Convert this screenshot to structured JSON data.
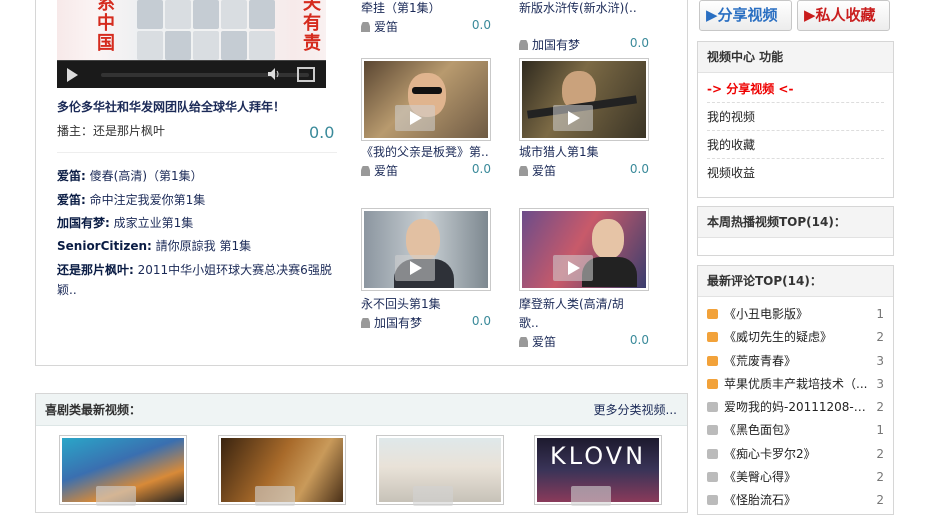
{
  "top_buttons": {
    "share": "▶分享视频",
    "collect": "▶私人收藏"
  },
  "featured": {
    "thumb_text_left": [
      "系",
      "中",
      "国"
    ],
    "thumb_text_right": [
      "夫",
      "有",
      "责"
    ],
    "title": "多伦多华社和华发网团队给全球华人拜年！",
    "uploader_label": "播主：还是那片枫叶",
    "score": "0.0"
  },
  "comments": [
    {
      "user": "爱笛:",
      "text": "傻春(高清)（第1集）"
    },
    {
      "user": "爱笛:",
      "text": "命中注定我爱你第1集"
    },
    {
      "user": "加国有梦:",
      "text": "成家立业第1集"
    },
    {
      "user": "SeniorCitizen:",
      "text": "請你原諒我 第1集"
    },
    {
      "user": "还是那片枫叶:",
      "text": "2011中华小姐环球大赛总决赛6强脱颖.."
    }
  ],
  "videos": {
    "v0": {
      "title": "牵挂（第1集）",
      "user": "爱笛",
      "score": "0.0"
    },
    "v1": {
      "title": "新版水浒传(新水浒)(..",
      "user": "加国有梦",
      "score": "0.0"
    },
    "v2": {
      "title": "《我的父亲是板凳》第..",
      "user": "爱笛",
      "score": "0.0"
    },
    "v3": {
      "title": "城市猎人第1集",
      "user": "爱笛",
      "score": "0.0"
    },
    "v4": {
      "title": "永不回头第1集",
      "user": "加国有梦",
      "score": "0.0"
    },
    "v5": {
      "title": "摩登新人类(高清/胡歌..",
      "user": "爱笛",
      "score": "0.0"
    }
  },
  "sidebar": {
    "func_title": "视频中心 功能",
    "func_items": [
      "-> 分享视频 <-",
      "我的视频",
      "我的收藏",
      "视频收益"
    ],
    "hot_title": "本周热播视频TOP(14)：",
    "comment_title": "最新评论TOP(14)：",
    "ranks": [
      {
        "text": "《小丑电影版》",
        "num": "1",
        "color": "#f2a23a"
      },
      {
        "text": "《威切先生的疑虑》",
        "num": "2",
        "color": "#f2a23a"
      },
      {
        "text": "《荒废青春》",
        "num": "3",
        "color": "#f2a23a"
      },
      {
        "text": "苹果优质丰产栽培技术（...",
        "num": "3",
        "color": "#f2a23a"
      },
      {
        "text": "爱吻我的妈-20111208-性...",
        "num": "2",
        "color": "#bbbbbb"
      },
      {
        "text": "《黑色面包》",
        "num": "1",
        "color": "#bbbbbb"
      },
      {
        "text": "《痴心卡罗尔2》",
        "num": "2",
        "color": "#bbbbbb"
      },
      {
        "text": "《美臀心得》",
        "num": "2",
        "color": "#bbbbbb"
      },
      {
        "text": "《怪胎流石》",
        "num": "2",
        "color": "#bbbbbb"
      }
    ]
  },
  "category": {
    "title": "喜剧类最新视频：",
    "more": "更多分类视频..."
  }
}
